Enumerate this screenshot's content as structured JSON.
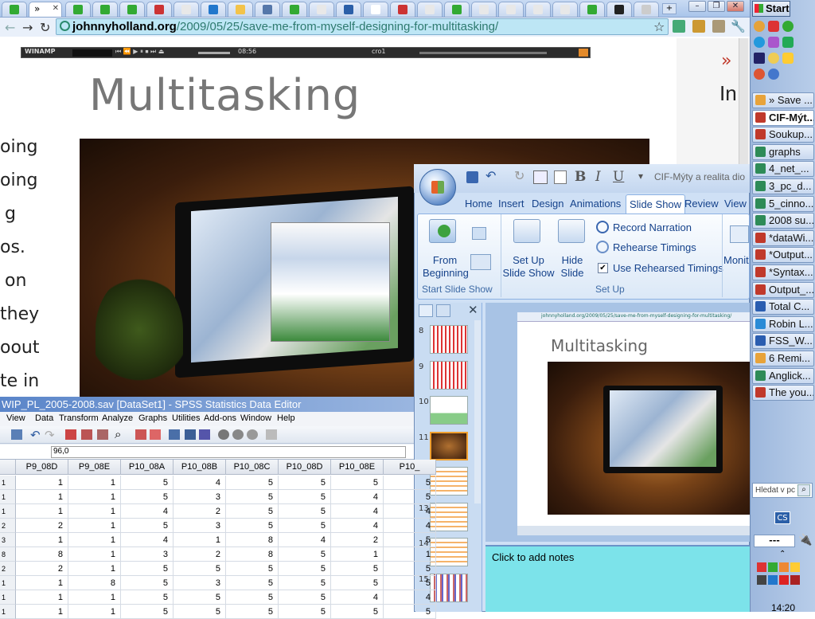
{
  "browser": {
    "url_host": "johnnyholland.org",
    "url_path": "/2009/05/25/save-me-from-myself-designing-for-multitasking/",
    "tab_label": "»"
  },
  "winamp": {
    "title": "WINAMP",
    "time": "08:56",
    "label": "cro1"
  },
  "page": {
    "heading": "Multitasking",
    "left_words": [
      "oing",
      "oing",
      "g",
      "os.",
      "on",
      "they",
      "oout",
      "te in"
    ],
    "right_chevron": "»",
    "right_text": "In"
  },
  "taskbar": {
    "start": "Start",
    "items": [
      {
        "label": "» Save ...",
        "color": "#e8a33a"
      },
      {
        "label": "CIF-Mýt...",
        "color": "#c0392b"
      },
      {
        "label": "Soukup...",
        "color": "#c0392b"
      },
      {
        "label": "graphs",
        "color": "#2e8b57"
      },
      {
        "label": "4_net_...",
        "color": "#2e8b57"
      },
      {
        "label": "3_pc_d...",
        "color": "#2e8b57"
      },
      {
        "label": "5_cinno...",
        "color": "#2e8b57"
      },
      {
        "label": "2008 su...",
        "color": "#2e8b57"
      },
      {
        "label": "*dataWi...",
        "color": "#c0392b"
      },
      {
        "label": "*Output...",
        "color": "#c0392b"
      },
      {
        "label": "*Syntax...",
        "color": "#c0392b"
      },
      {
        "label": "Output_...",
        "color": "#c0392b"
      },
      {
        "label": "Total C...",
        "color": "#2a5db0"
      },
      {
        "label": "Robin L...",
        "color": "#2a8bd6"
      },
      {
        "label": "FSS_W...",
        "color": "#2a5db0"
      },
      {
        "label": "6 Remi...",
        "color": "#e8a33a"
      },
      {
        "label": "Anglick...",
        "color": "#2e8b57"
      },
      {
        "label": "The you...",
        "color": "#c0392b"
      }
    ],
    "search_placeholder": "Hledat v pc",
    "lang": "CS",
    "dashes": "---",
    "clock": "14:20"
  },
  "ppt": {
    "doc_title": "CIF-Mýty a realita dio",
    "tabs": [
      "Home",
      "Insert",
      "Design",
      "Animations",
      "Slide Show",
      "Review",
      "View"
    ],
    "active_tab": "Slide Show",
    "from_beginning": "From\nBeginning",
    "setup_show": "Set Up\nSlide Show",
    "hide_slide": "Hide\nSlide",
    "record_narration": "Record Narration",
    "rehearse_timings": "Rehearse Timings",
    "use_rehearsed": "Use Rehearsed Timings",
    "monitor": "Monit",
    "group_start": "Start Slide Show",
    "group_setup": "Set Up",
    "slide_numbers": [
      "8",
      "9",
      "10",
      "11",
      "12",
      "13",
      "14",
      "15"
    ],
    "notes_placeholder": "Click to add notes",
    "slide_heading": "Multitasking",
    "slide_url": "johnnyholland.org/2009/05/25/save-me-from-myself-designing-for-multitasking/"
  },
  "spss": {
    "title": "WIP_PL_2005-2008.sav [DataSet1] - SPSS Statistics Data Editor",
    "menu": [
      "View",
      "Data",
      "Transform",
      "Analyze",
      "Graphs",
      "Utilities",
      "Add-ons",
      "Window",
      "Help"
    ],
    "cell_value": "96,0",
    "columns": [
      "P9_08D",
      "P9_08E",
      "P10_08A",
      "P10_08B",
      "P10_08C",
      "P10_08D",
      "P10_08E",
      "P10_"
    ],
    "row_labels": [
      "1",
      "1",
      "1",
      "2",
      "3",
      "8",
      "2",
      "1",
      "1",
      "1"
    ],
    "rows": [
      [
        "1",
        "1",
        "5",
        "4",
        "5",
        "5",
        "5",
        "5"
      ],
      [
        "1",
        "1",
        "5",
        "3",
        "5",
        "5",
        "4",
        "5"
      ],
      [
        "1",
        "1",
        "4",
        "2",
        "5",
        "5",
        "4",
        "4"
      ],
      [
        "2",
        "1",
        "5",
        "3",
        "5",
        "5",
        "4",
        "4"
      ],
      [
        "1",
        "1",
        "4",
        "1",
        "8",
        "4",
        "2",
        "5"
      ],
      [
        "8",
        "1",
        "3",
        "2",
        "8",
        "5",
        "1",
        "1"
      ],
      [
        "2",
        "1",
        "5",
        "5",
        "5",
        "5",
        "5",
        "5"
      ],
      [
        "1",
        "8",
        "5",
        "3",
        "5",
        "5",
        "5",
        "5"
      ],
      [
        "1",
        "1",
        "5",
        "5",
        "5",
        "5",
        "4",
        "4"
      ],
      [
        "1",
        "1",
        "5",
        "5",
        "5",
        "5",
        "5",
        "5"
      ]
    ]
  }
}
